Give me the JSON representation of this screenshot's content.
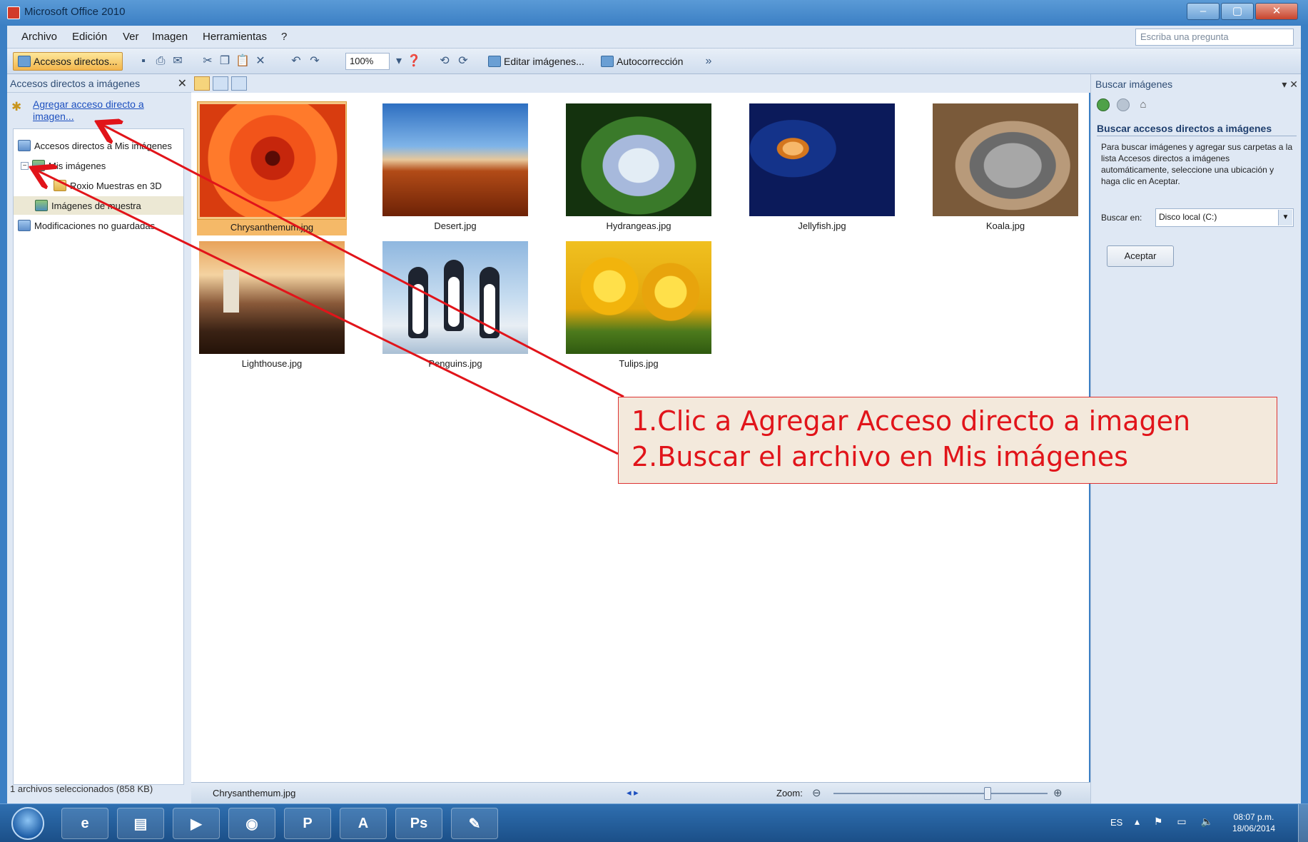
{
  "window": {
    "title": "Microsoft Office 2010",
    "caption_buttons": [
      "–",
      "▢",
      "✕"
    ]
  },
  "menu": {
    "items": [
      "Archivo",
      "Edición",
      "Ver",
      "Imagen",
      "Herramientas",
      "?"
    ],
    "ask_placeholder": "Escriba una pregunta"
  },
  "toolbar": {
    "shortcuts_label": "Accesos directos...",
    "zoom_value": "100%",
    "edit_images_label": "Editar imágenes...",
    "autocorrect_label": "Autocorrección"
  },
  "left_pane": {
    "title": "Accesos directos a imágenes",
    "add_link": "Agregar acceso directo a imagen...",
    "tree": [
      {
        "label": "Accesos directos a Mis imágenes"
      },
      {
        "label": "Mis imágenes"
      },
      {
        "label": "Roxio Muestras en 3D"
      },
      {
        "label": "Imágenes de muestra"
      },
      {
        "label": "Modificaciones no guardadas"
      }
    ],
    "status": "1 archivos seleccionados (858 KB)"
  },
  "thumbnails": [
    {
      "name": "Chrysanthemum.jpg",
      "selected": true
    },
    {
      "name": "Desert.jpg"
    },
    {
      "name": "Hydrangeas.jpg"
    },
    {
      "name": "Jellyfish.jpg"
    },
    {
      "name": "Koala.jpg"
    },
    {
      "name": "Lighthouse.jpg"
    },
    {
      "name": "Penguins.jpg"
    },
    {
      "name": "Tulips.jpg"
    }
  ],
  "right_pane": {
    "title": "Buscar imágenes",
    "section_title": "Buscar accesos directos a imágenes",
    "description": "Para buscar imágenes y agregar sus carpetas a la lista Accesos directos a imágenes automáticamente, seleccione una ubicación y haga clic en Aceptar.",
    "search_in_label": "Buscar en:",
    "search_in_value": "Disco local (C:)",
    "accept_button": "Aceptar"
  },
  "status_bar": {
    "file_name": "Chrysanthemum.jpg",
    "zoom_label": "Zoom:",
    "zoom_level": 0.72
  },
  "taskbar": {
    "apps": [
      "IE",
      "Explorer",
      "Media Player",
      "Chrome",
      "PowerPoint",
      "Acrobat",
      "Photoshop",
      "Office Picture Manager"
    ],
    "language": "ES",
    "time": "08:07 p.m.",
    "date": "18/06/2014"
  },
  "annotation": {
    "steps": [
      "1.Clic a Agregar Acceso directo a imagen",
      "2.Buscar el archivo en Mis imágenes"
    ],
    "color": "#e1141a"
  }
}
